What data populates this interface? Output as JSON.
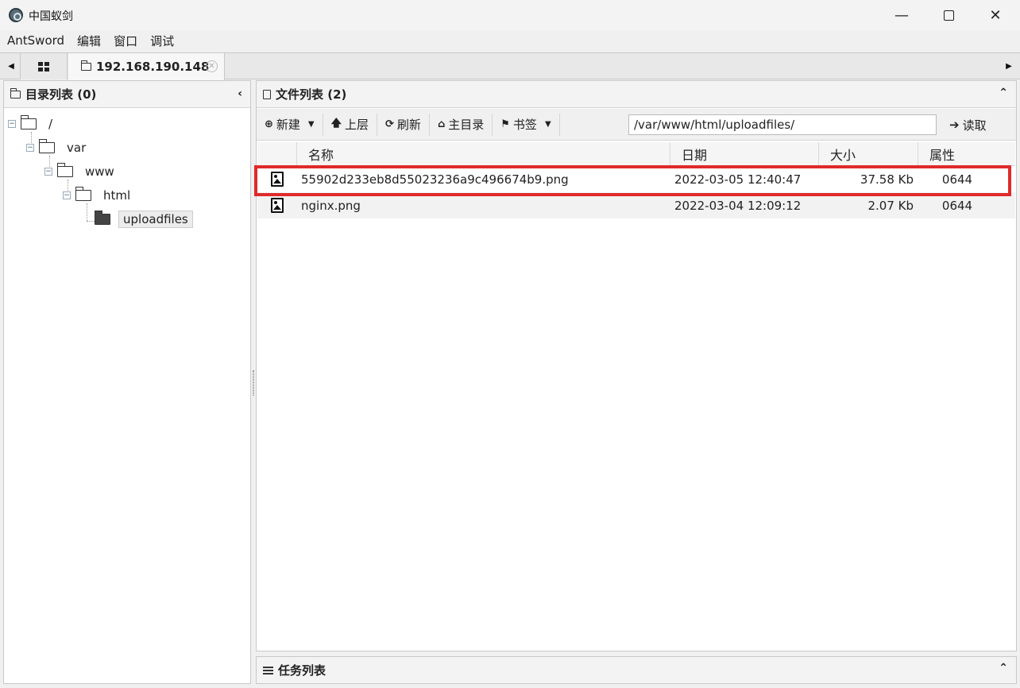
{
  "window": {
    "title": "中国蚁剑",
    "controls": {
      "minimize": "—",
      "close": "✕"
    }
  },
  "menubar": {
    "items": [
      "AntSword",
      "编辑",
      "窗口",
      "调试"
    ]
  },
  "tabs": {
    "active_label": "192.168.190.148",
    "close_glyph": "✕",
    "left_arrow": "◀",
    "right_arrow": "▶"
  },
  "left_panel": {
    "header": "目录列表 (0)",
    "collapse_glyph": "‹",
    "tree": [
      {
        "label": "/",
        "level": 0
      },
      {
        "label": "var",
        "level": 1
      },
      {
        "label": "www",
        "level": 2
      },
      {
        "label": "html",
        "level": 3
      },
      {
        "label": "uploadfiles",
        "level": 4,
        "selected": true
      }
    ],
    "toggle_glyph": "−"
  },
  "right_panel": {
    "header": "文件列表 (2)",
    "expand_glyph": "⌃",
    "toolbar": {
      "new_label": "新建",
      "up_label": "上层",
      "refresh_label": "刷新",
      "home_label": "主目录",
      "bookmark_label": "书签",
      "path_value": "/var/www/html/uploadfiles/",
      "read_label": "读取",
      "icons": {
        "new": "⊕",
        "up": "🡅",
        "refresh": "⟳",
        "home": "⌂",
        "bookmark": "⚑",
        "read": "➔",
        "caret": "▼"
      }
    },
    "columns": [
      "名称",
      "日期",
      "大小",
      "属性"
    ],
    "rows": [
      {
        "icon": "image-file-icon",
        "name": "55902d233eb8d55023236a9c496674b9.png",
        "date": "2022-03-05 12:40:47",
        "size": "37.58 Kb",
        "attr": "0644",
        "highlighted": true
      },
      {
        "icon": "image-file-icon",
        "name": "nginx.png",
        "date": "2022-03-04 12:09:12",
        "size": "2.07 Kb",
        "attr": "0644"
      }
    ]
  },
  "task_panel": {
    "header": "任务列表",
    "expand_glyph": "⌃"
  },
  "colors": {
    "highlight": "#e02a2a",
    "panel_bg": "#f3f3f3",
    "grid_alt": "#f2f2f2"
  }
}
